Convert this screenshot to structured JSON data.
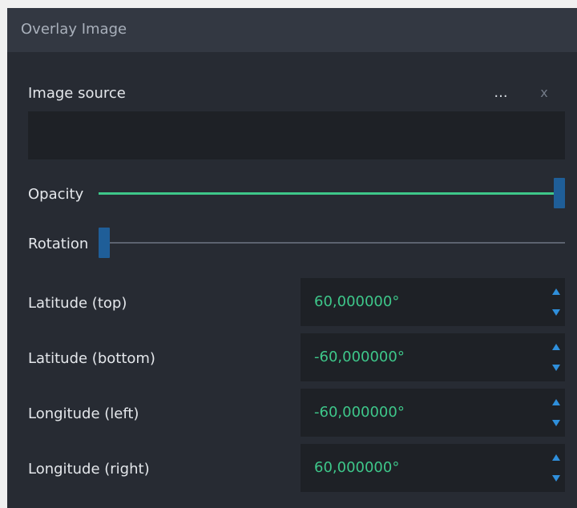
{
  "window": {
    "title": "Overlay Image"
  },
  "image_source": {
    "label": "Image source",
    "browse_label": "...",
    "clear_label": "x",
    "value": ""
  },
  "opacity": {
    "label": "Opacity",
    "value_fraction": 1.0
  },
  "rotation": {
    "label": "Rotation",
    "value_fraction": 0.0
  },
  "fields": [
    {
      "label": "Latitude (top)",
      "value": "60,000000°"
    },
    {
      "label": "Latitude (bottom)",
      "value": "-60,000000°"
    },
    {
      "label": "Longitude (left)",
      "value": "-60,000000°"
    },
    {
      "label": "Longitude (right)",
      "value": "60,000000°"
    }
  ],
  "colors": {
    "panel_bg": "#272b33",
    "title_bg": "#333842",
    "field_bg": "#1e2126",
    "accent_green": "#3ec78a",
    "handle_blue": "#1f5e98",
    "spin_arrow_blue": "#2f8fdb",
    "track_gray": "#5c6370"
  },
  "icons": {
    "spin_up": "triangle-up-icon",
    "spin_down": "triangle-down-icon"
  }
}
